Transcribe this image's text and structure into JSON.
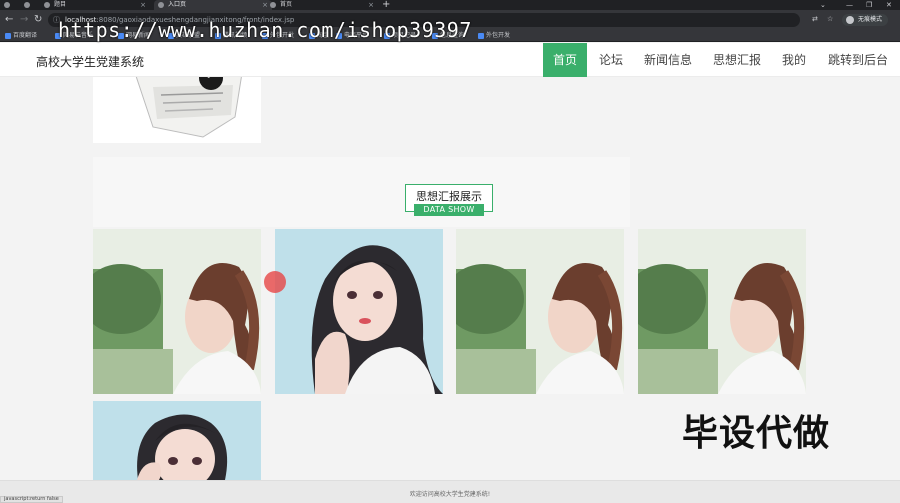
{
  "browser": {
    "tabs": [
      {
        "label": ""
      },
      {
        "label": ""
      },
      {
        "label": "题目"
      },
      {
        "label": "入口页"
      },
      {
        "label": "首页"
      }
    ],
    "url_host": "localhost",
    "url_rest": ":8080/gaoxiaodaxueshengdangjianxitong/front/index.jsp",
    "incognito_label": "无痕模式",
    "bookmarks": [
      "百度翻译",
      "网易云音乐",
      "网易新闻",
      "英雄联盟",
      "腾讯视频",
      "外包开发",
      "淘宝",
      "电商平台",
      "项目记录",
      "信息查询",
      "外包开发",
      "网站列表"
    ]
  },
  "watermark": "https://www.huzhan.com/ishop39397",
  "site": {
    "title": "高校大学生党建系统",
    "nav": [
      {
        "label": "首页"
      },
      {
        "label": "论坛"
      },
      {
        "label": "新闻信息"
      },
      {
        "label": "思想汇报"
      },
      {
        "label": "我的"
      },
      {
        "label": "跳转到后台"
      }
    ]
  },
  "section": {
    "title": "思想汇报展示",
    "subtitle": "DATA SHOW"
  },
  "photos": [
    "girl-profile-photo",
    "girl-portrait-photo",
    "girl-profile-photo",
    "girl-profile-photo",
    "girl-portrait-photo"
  ],
  "overlay_text": "毕设代做",
  "footer": {
    "welcome": "欢迎访问高校大学生党建系统!"
  },
  "status": {
    "js_text": "javascript:return false"
  },
  "colors": {
    "accent": "#3aaf6b",
    "chrome_dark": "#202124"
  }
}
